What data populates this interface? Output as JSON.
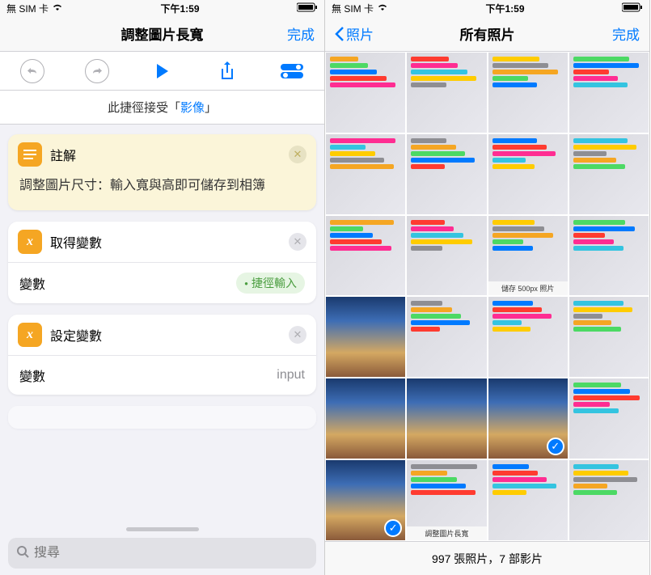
{
  "status": {
    "carrier": "無 SIM 卡",
    "wifi": "wifi-icon",
    "time": "下午1:59",
    "battery": "battery-icon"
  },
  "left": {
    "title": "調整圖片長寬",
    "done": "完成",
    "accepts_prefix": "此捷徑接受「",
    "accepts_type": "影像",
    "accepts_suffix": "」",
    "note": {
      "title": "註解",
      "body": "調整圖片尺寸：輸入寬與高即可儲存到相簿"
    },
    "getvar": {
      "title": "取得變數",
      "row_label": "變數",
      "row_value": "捷徑輸入"
    },
    "setvar": {
      "title": "設定變數",
      "row_label": "變數",
      "row_value": "input"
    },
    "search_placeholder": "搜尋"
  },
  "right": {
    "back": "照片",
    "title": "所有照片",
    "done": "完成",
    "footer": "997 張照片，7 部影片",
    "thumbs": [
      {
        "cap": ""
      },
      {
        "cap": ""
      },
      {
        "cap": ""
      },
      {
        "cap": ""
      },
      {
        "cap": ""
      },
      {
        "cap": ""
      },
      {
        "cap": ""
      },
      {
        "cap": ""
      },
      {
        "cap": ""
      },
      {
        "cap": ""
      },
      {
        "cap": "儲存 500px 照片"
      },
      {
        "cap": ""
      },
      {
        "cap": "",
        "city": true
      },
      {
        "cap": ""
      },
      {
        "cap": ""
      },
      {
        "cap": ""
      },
      {
        "cap": "",
        "city": true
      },
      {
        "cap": "",
        "city": true
      },
      {
        "cap": "",
        "city": true,
        "sel": true
      },
      {
        "cap": ""
      },
      {
        "cap": "",
        "city": true,
        "sel": true
      },
      {
        "cap": "調整圖片長寬"
      },
      {
        "cap": ""
      },
      {
        "cap": ""
      }
    ]
  }
}
